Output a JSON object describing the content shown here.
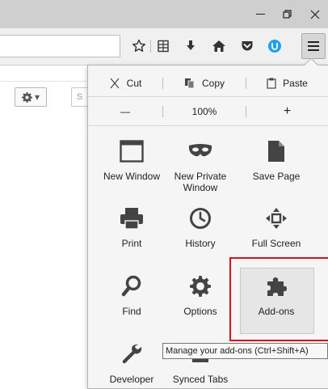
{
  "window": {
    "minimize_glyph": "—",
    "maximize_glyph": "❐",
    "close_glyph": "✕"
  },
  "toolbar": {
    "icons": [
      "bookmark-star-icon",
      "reading-list-icon",
      "download-icon",
      "home-icon",
      "pocket-icon",
      "ublock-icon",
      "menu-icon"
    ]
  },
  "page": {
    "gear_caret": "▾",
    "input_char": "S"
  },
  "menu": {
    "edit": {
      "cut": "Cut",
      "copy": "Copy",
      "paste": "Paste"
    },
    "zoom": {
      "out": "—",
      "level": "100%",
      "in": "+"
    },
    "tiles": [
      {
        "label": "New Window",
        "icon": "window-icon"
      },
      {
        "label": "New Private\nWindow",
        "icon": "mask-icon"
      },
      {
        "label": "Save Page",
        "icon": "page-icon"
      },
      {
        "label": "Print",
        "icon": "printer-icon"
      },
      {
        "label": "History",
        "icon": "clock-icon"
      },
      {
        "label": "Full Screen",
        "icon": "fullscreen-icon"
      },
      {
        "label": "Find",
        "icon": "magnifier-icon"
      },
      {
        "label": "Options",
        "icon": "gear-icon"
      },
      {
        "label": "Add-ons",
        "icon": "puzzle-icon"
      },
      {
        "label": "Developer",
        "icon": "wrench-icon"
      },
      {
        "label": "Synced Tabs",
        "icon": "sync-icon"
      }
    ]
  },
  "tooltip": {
    "text": "Manage your add-ons (Ctrl+Shift+A)"
  },
  "colors": {
    "highlight": "#e0131a",
    "titlebar": "#cfcfcf",
    "ublock": "#1ea0f0"
  }
}
